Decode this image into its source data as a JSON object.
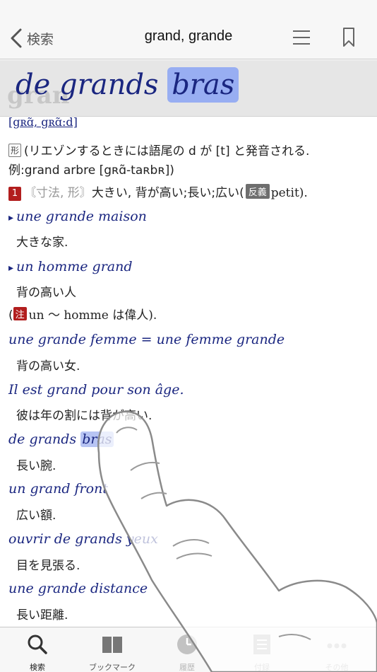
{
  "nav": {
    "back_label": "検索",
    "title": "grand, grande"
  },
  "banner": {
    "ghost": "gran",
    "lead": "de grands ",
    "highlight": "bras"
  },
  "entry": {
    "pronunciation": "[gʀɑ̃, gʀɑ̃:d]",
    "pos_tag": "形",
    "liaison_note_1": "(リエゾンするときには語尾の d が [t] と発音される.",
    "liaison_note_2": "例:grand arbre [gʀɑ̃-taʀbʀ])",
    "sense_number": "1",
    "usage": "〘寸法, 形〙",
    "sense_text": "大きい, 背が高い;長い;広い(",
    "antonym_tag": "反義",
    "antonym": "petit).",
    "examples": [
      {
        "fr": "une grande maison",
        "jp": "大きな家."
      },
      {
        "fr": "un homme grand",
        "jp": "背の高い人"
      },
      {
        "fr": "une grande femme = une femme grande",
        "jp": "背の高い女."
      },
      {
        "fr": "Il est grand pour son âge.",
        "jp": "彼は年の割には背が高い."
      },
      {
        "fr_lead": "de grands ",
        "fr_hl": "bras",
        "jp": "長い腕."
      },
      {
        "fr": "un grand front",
        "jp": "広い額."
      },
      {
        "fr": "ouvrir de grands yeux",
        "jp": "目を見張る."
      },
      {
        "fr": "une grande distance",
        "jp": "長い距離."
      }
    ],
    "note_tag": "注",
    "note_text": "un 〜 homme は偉人).",
    "note_open": "("
  },
  "tabs": [
    {
      "label": "検索",
      "icon": "search-icon"
    },
    {
      "label": "ブックマーク",
      "icon": "book-icon"
    },
    {
      "label": "履歴",
      "icon": "clock-icon"
    },
    {
      "label": "付録",
      "icon": "document-icon"
    },
    {
      "label": "その他",
      "icon": "more-icon"
    }
  ],
  "colors": {
    "example_text": "#1a2680",
    "highlight": "#98aef2",
    "badge_red": "#b21e1e"
  }
}
